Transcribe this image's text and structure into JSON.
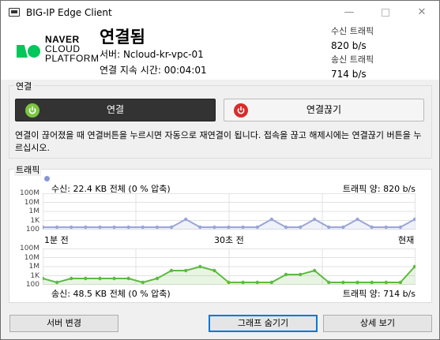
{
  "window": {
    "title": "BIG-IP Edge Client"
  },
  "logo": {
    "line1": "NAVER",
    "line2": "CLOUD",
    "line3": "PLATFORM"
  },
  "status": {
    "title": "연결됨",
    "server": "서버: Ncloud-kr-vpc-01",
    "duration": "연결 지속 시간: 00:04:01"
  },
  "header_traffic": {
    "rx_label": "수신 트래픽",
    "rx_value": "820 b/s",
    "tx_label": "송신 트래픽",
    "tx_value": "714 b/s"
  },
  "connection": {
    "group_label": "연결",
    "connect_label": "연결",
    "disconnect_label": "연결끊기",
    "description": "연결이 끊어졌을 때 연결버튼을 누르시면 자동으로 재연결이 됩니다. 접속을 끊고 해제시에는 연결끊기 버튼을 누르십시오."
  },
  "traffic": {
    "group_label": "트래픽",
    "rx_summary": "수신: 22.4 KB 전체 (0 % 압축)",
    "rx_rate": "트래픽 양: 820 b/s",
    "tx_summary": "송신: 48.5 KB 전체 (0 % 압축)",
    "tx_rate": "트래픽 양: 714 b/s",
    "y_ticks": [
      "100M",
      "10M",
      "1M",
      "1K",
      "100"
    ],
    "x_ticks": [
      "1분 전",
      "30초 전",
      "현재"
    ],
    "colors": {
      "rx": "#9aa5d8",
      "tx": "#5dba3f"
    }
  },
  "buttons": {
    "server_change": "서버 변경",
    "hide_graph": "그래프 숨기기",
    "details": "상세 보기"
  },
  "chart_data": [
    {
      "type": "area",
      "series": [
        {
          "name": "수신",
          "values": [
            0,
            0,
            0,
            0,
            0,
            0,
            0,
            0,
            0,
            0,
            1,
            0,
            0,
            0,
            0,
            0,
            1,
            0,
            0,
            1,
            0,
            0,
            1,
            0,
            0,
            0,
            1
          ]
        }
      ],
      "ylabel": "",
      "y_scale": "log",
      "y_ticks": [
        "100M",
        "10M",
        "1M",
        "1K",
        "100"
      ],
      "x_ticks": [
        "1분 전",
        "30초 전",
        "현재"
      ],
      "grid": true
    },
    {
      "type": "area",
      "series": [
        {
          "name": "송신",
          "values": [
            0.5,
            0,
            0.5,
            0.5,
            0.5,
            0.5,
            0.5,
            0,
            0.5,
            1.5,
            1.5,
            2,
            1.5,
            0,
            0,
            0,
            0,
            1,
            1,
            1.5,
            0,
            0,
            0,
            0,
            0,
            0,
            2
          ]
        }
      ],
      "ylabel": "",
      "y_scale": "log",
      "y_ticks": [
        "100M",
        "10M",
        "1M",
        "1K",
        "100"
      ],
      "x_ticks": [
        "1분 전",
        "30초 전",
        "현재"
      ],
      "grid": true
    }
  ]
}
